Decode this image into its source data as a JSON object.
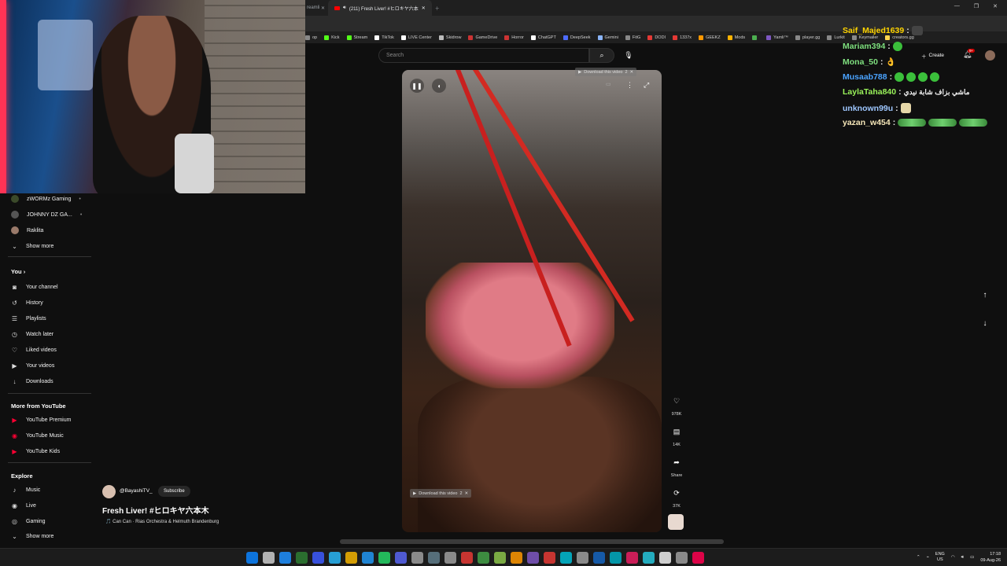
{
  "browser": {
    "prev_tab_label": "reamli",
    "active_tab_title": "(211) Fresh Liver! #ヒロキヤ六本",
    "window_controls": [
      "—",
      "❐",
      "✕"
    ],
    "bookmarks": [
      {
        "label": "op",
        "color": "#888888"
      },
      {
        "label": "Kick",
        "color": "#53fc18"
      },
      {
        "label": "Stream",
        "color": "#53fc18"
      },
      {
        "label": "TikTok",
        "color": "#ffffff"
      },
      {
        "label": "LIVE Center",
        "color": "#ffffff"
      },
      {
        "label": "Skidrow",
        "color": "#bbbbbb"
      },
      {
        "label": "GameDrive",
        "color": "#cc3333"
      },
      {
        "label": "Horror",
        "color": "#cc3333"
      },
      {
        "label": "ChatGPT",
        "color": "#ffffff"
      },
      {
        "label": "DeepSeek",
        "color": "#4d6bfe"
      },
      {
        "label": "Gemini",
        "color": "#8ab4f8"
      },
      {
        "label": "FitG",
        "color": "#888888"
      },
      {
        "label": "DODI",
        "color": "#e53935"
      },
      {
        "label": "1337x",
        "color": "#e53935"
      },
      {
        "label": "GEEKZ",
        "color": "#ff9800"
      },
      {
        "label": "Mods",
        "color": "#ffb300"
      },
      {
        "label": "",
        "color": "#4caf50"
      },
      {
        "label": "Yamli™",
        "color": "#7e57c2"
      },
      {
        "label": "player.gg",
        "color": "#888888"
      },
      {
        "label": "Lurkit",
        "color": "#888888"
      },
      {
        "label": "Keymailer",
        "color": "#888888"
      },
      {
        "label": "creators.gg",
        "color": "#ffd54f"
      }
    ]
  },
  "header": {
    "search_placeholder": "Search",
    "create_label": "Create",
    "notif_badge": "9+"
  },
  "sidebar": {
    "subscriptions": [
      {
        "label": "zWORMz Gaming"
      },
      {
        "label": "JOHNNY DZ GA..."
      },
      {
        "label": "Raklita"
      }
    ],
    "show_more_1": "Show more",
    "you_heading": "You",
    "you_items": [
      {
        "label": "Your channel",
        "icon": "◙"
      },
      {
        "label": "History",
        "icon": "↺"
      },
      {
        "label": "Playlists",
        "icon": "☰"
      },
      {
        "label": "Watch later",
        "icon": "◷"
      },
      {
        "label": "Liked videos",
        "icon": "♡"
      },
      {
        "label": "Your videos",
        "icon": "▶"
      },
      {
        "label": "Downloads",
        "icon": "↓"
      }
    ],
    "more_heading": "More from YouTube",
    "more_items": [
      {
        "label": "YouTube Premium"
      },
      {
        "label": "YouTube Music"
      },
      {
        "label": "YouTube Kids"
      }
    ],
    "explore_heading": "Explore",
    "explore_items": [
      {
        "label": "Music",
        "icon": "♪"
      },
      {
        "label": "Live",
        "icon": "◉"
      },
      {
        "label": "Gaming",
        "icon": "◎"
      }
    ],
    "show_more_2": "Show more"
  },
  "video": {
    "download_label": "Download this video",
    "download_count": "2",
    "channel": "@BayashiTV_",
    "subscribe_label": "Subscribe",
    "title": "Fresh Liver! #ヒロキヤ六本木",
    "music": "🎵 Can Can · Rias Orchestra & Helmuth Brandenburg",
    "likes": "978K",
    "comments": "14K",
    "share_label": "Share",
    "remixes": "37K"
  },
  "chat": [
    {
      "user": "Saif_Majed1639",
      "color": "#ffd400",
      "text": "",
      "emote": "dark"
    },
    {
      "user": "Mariam394",
      "color": "#7fe07f",
      "text": "",
      "emote": "green"
    },
    {
      "user": "Mona_50",
      "color": "#7fe07f",
      "text": "👌",
      "emote": ""
    },
    {
      "user": "Musaab788",
      "color": "#4aa3ff",
      "text": "",
      "emote": "green4"
    },
    {
      "user": "LaylaTaha840",
      "color": "#9af25a",
      "text": "ماشي بزاف شابة نيدي",
      "emote": ""
    },
    {
      "user": "unknown99u",
      "color": "#9ec7ff",
      "text": "",
      "emote": "tan"
    },
    {
      "user": "yazan_w454",
      "color": "#f5e6b8",
      "text": "",
      "emote": "pepe3"
    }
  ],
  "tray": {
    "lang": "ENG",
    "region": "US",
    "time": "17:18",
    "date": "09-Aug-26"
  }
}
